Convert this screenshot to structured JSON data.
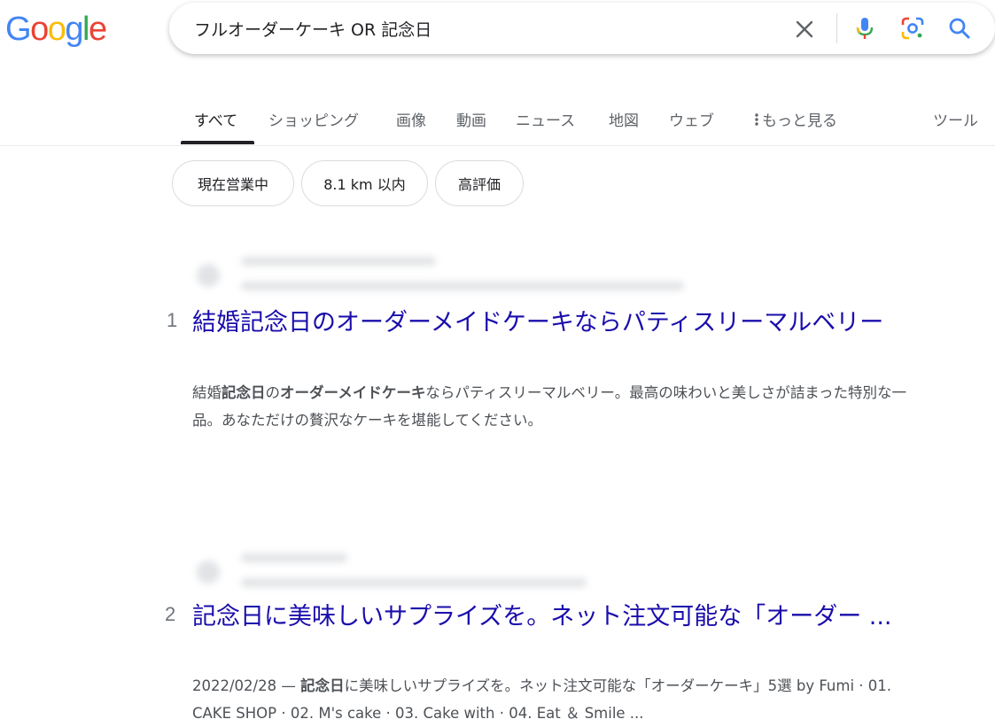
{
  "logo": {
    "letters": [
      "G",
      "o",
      "o",
      "g",
      "l",
      "e"
    ],
    "colors": [
      "#4285F4",
      "#EA4335",
      "#FBBC05",
      "#4285F4",
      "#34A853",
      "#EA4335"
    ]
  },
  "search": {
    "query": "フルオーダーケーキ OR 記念日",
    "icons": [
      "close-icon",
      "mic-icon",
      "lens-icon",
      "search-icon"
    ]
  },
  "tabs": [
    {
      "label": "すべて",
      "active": true
    },
    {
      "label": "ショッピング"
    },
    {
      "label": "画像"
    },
    {
      "label": "動画"
    },
    {
      "label": "ニュース"
    },
    {
      "label": "地図"
    },
    {
      "label": "ウェブ"
    },
    {
      "label": "もっと見る"
    },
    {
      "label": "ツール"
    }
  ],
  "chips": [
    "現在営業中",
    "8.1 km 以内",
    "高評価"
  ],
  "results": [
    {
      "rank": "1",
      "title": "結婚記念日のオーダーメイドケーキならパティスリーマルベリー",
      "snippet_parts": [
        {
          "text": "結婚",
          "bold": false
        },
        {
          "text": "記念日",
          "bold": true
        },
        {
          "text": "の",
          "bold": false
        },
        {
          "text": "オーダーメイドケーキ",
          "bold": true
        },
        {
          "text": "ならパティスリーマルベリー。最高の味わいと美しさが詰まった特別な一品。あなただけの贅沢なケーキを堪能してください。",
          "bold": false
        }
      ]
    },
    {
      "rank": "2",
      "title": "記念日に美味しいサプライズを。ネット注文可能な「オーダー ...",
      "snippet_parts": [
        {
          "text": "2022/02/28 — ",
          "bold": false
        },
        {
          "text": "記念日",
          "bold": true
        },
        {
          "text": "に美味しいサプライズを。ネット注文可能な「オーダーケーキ」5選 by Fumi · 01. CAKE SHOP · 02. M's cake · 03. Cake with · 04. Eat ＆ Smile ...",
          "bold": false
        }
      ]
    }
  ],
  "colors": {
    "link": "#1a0dab",
    "snippet": "#4d5156",
    "tab_inactive": "#5f6368"
  }
}
